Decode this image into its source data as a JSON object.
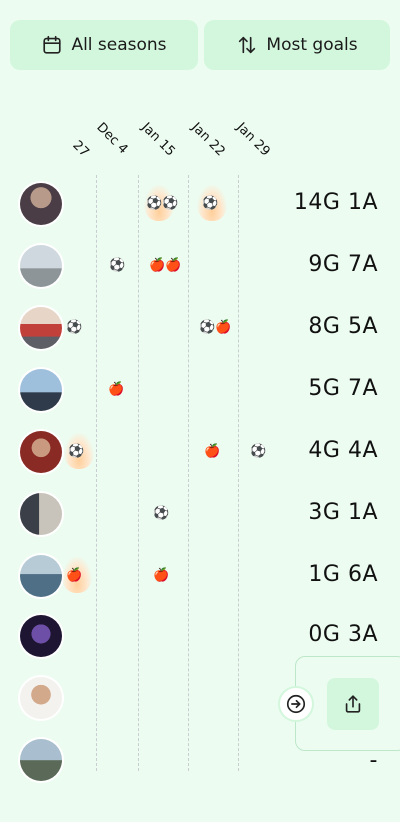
{
  "filters": {
    "seasons_label": "All seasons",
    "sort_label": "Most goals",
    "seasons_icon": "calendar-icon",
    "sort_icon": "sort-arrows-icon"
  },
  "dates": [
    "27",
    "Dec 4",
    "Jan 15",
    "Jan 22",
    "Jan 29"
  ],
  "players": [
    {
      "score": "14G 1A"
    },
    {
      "score": "9G 7A"
    },
    {
      "score": "8G 5A"
    },
    {
      "score": "5G 7A"
    },
    {
      "score": "4G 4A"
    },
    {
      "score": "3G 1A"
    },
    {
      "score": "1G 6A"
    },
    {
      "score": "0G 3A"
    },
    {
      "score": ""
    },
    {
      "score": "-"
    }
  ],
  "legend_icons": {
    "goal": "⚽",
    "assist": "🍎"
  },
  "actions": {
    "next_icon": "arrow-right-circle-icon",
    "share_icon": "share-icon"
  },
  "colors": {
    "background": "#ecfcf1",
    "button": "#d3f7dd"
  }
}
